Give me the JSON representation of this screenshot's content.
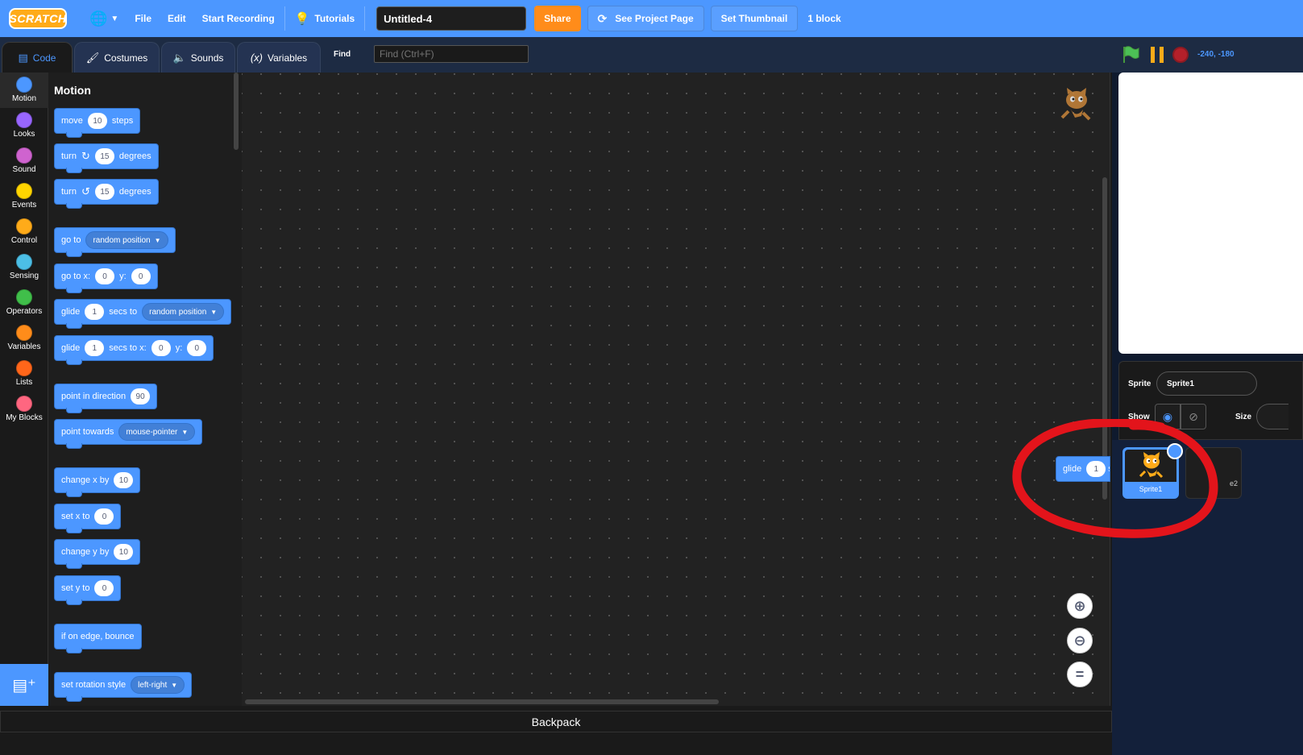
{
  "menubar": {
    "logo_text": "SCRATCH",
    "file": "File",
    "edit": "Edit",
    "start_recording": "Start Recording",
    "tutorials": "Tutorials",
    "project_title": "Untitled-4",
    "share": "Share",
    "see_project_page": "See Project Page",
    "set_thumbnail": "Set Thumbnail",
    "block_count": "1 block"
  },
  "tabs": {
    "code": "Code",
    "costumes": "Costumes",
    "sounds": "Sounds",
    "variables": "Variables",
    "find_label": "Find",
    "find_placeholder": "Find (Ctrl+F)"
  },
  "stage_header": {
    "coords": "-240, -180"
  },
  "categories": [
    {
      "label": "Motion",
      "color": "#4c97ff"
    },
    {
      "label": "Looks",
      "color": "#9966ff"
    },
    {
      "label": "Sound",
      "color": "#cf63cf"
    },
    {
      "label": "Events",
      "color": "#ffd500"
    },
    {
      "label": "Control",
      "color": "#ffab19"
    },
    {
      "label": "Sensing",
      "color": "#4cbfe6"
    },
    {
      "label": "Operators",
      "color": "#40bf4a"
    },
    {
      "label": "Variables",
      "color": "#ff8c1a"
    },
    {
      "label": "Lists",
      "color": "#ff661a"
    },
    {
      "label": "My Blocks",
      "color": "#ff6680"
    }
  ],
  "palette": {
    "title": "Motion",
    "move": {
      "t1": "move",
      "v": "10",
      "t2": "steps"
    },
    "turn_right": {
      "t1": "turn",
      "v": "15",
      "t2": "degrees"
    },
    "turn_left": {
      "t1": "turn",
      "v": "15",
      "t2": "degrees"
    },
    "go_to": {
      "t1": "go to",
      "dd": "random position"
    },
    "go_to_xy": {
      "t1": "go to x:",
      "x": "0",
      "t2": "y:",
      "y": "0"
    },
    "glide_to": {
      "t1": "glide",
      "v": "1",
      "t2": "secs to",
      "dd": "random position"
    },
    "glide_xy": {
      "t1": "glide",
      "v": "1",
      "t2": "secs to x:",
      "x": "0",
      "t3": "y:",
      "y": "0"
    },
    "point_dir": {
      "t1": "point in direction",
      "v": "90"
    },
    "point_towards": {
      "t1": "point towards",
      "dd": "mouse-pointer"
    },
    "change_x": {
      "t1": "change x by",
      "v": "10"
    },
    "set_x": {
      "t1": "set x to",
      "v": "0"
    },
    "change_y": {
      "t1": "change y by",
      "v": "10"
    },
    "set_y": {
      "t1": "set y to",
      "v": "0"
    },
    "bounce": {
      "t1": "if on edge, bounce"
    },
    "rotation": {
      "t1": "set rotation style",
      "dd": "left-right"
    }
  },
  "workspace": {
    "drag_block": {
      "t1": "glide",
      "v": "1",
      "t2": "s"
    }
  },
  "backpack": "Backpack",
  "sprite_info": {
    "sprite_label": "Sprite",
    "sprite_name": "Sprite1",
    "show_label": "Show",
    "size_label": "Size"
  },
  "sprites": [
    {
      "name": "Sprite1"
    },
    {
      "name": "e2"
    }
  ],
  "colors": {
    "menubar": "#4c97ff",
    "share": "#ff8c1a",
    "annotation": "#e3141b"
  }
}
